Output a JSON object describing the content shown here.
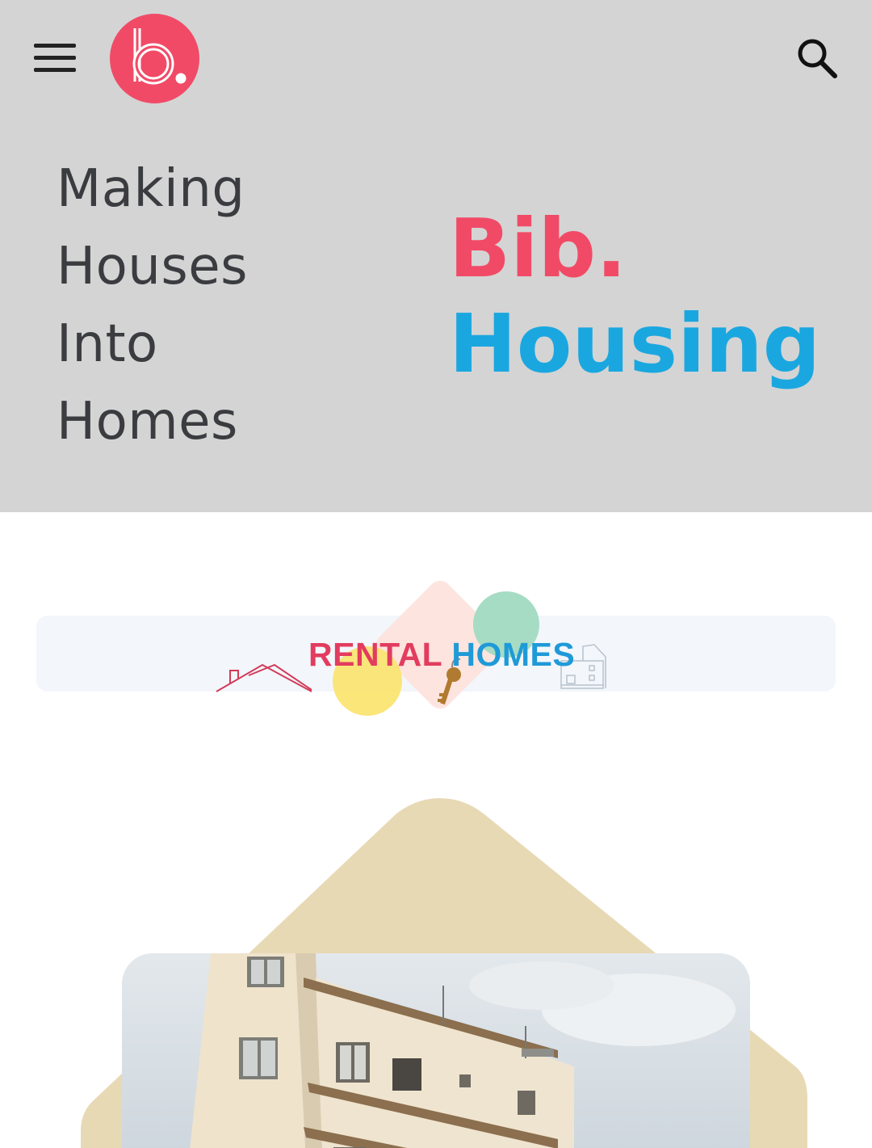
{
  "header": {
    "menu_icon": "hamburger-menu-icon",
    "logo_letter": "b.",
    "search_icon": "search-icon"
  },
  "hero": {
    "tagline": [
      "Making",
      "Houses",
      "Into",
      "Homes"
    ],
    "brand_line1": "Bib.",
    "brand_line2": "Housing"
  },
  "banner": {
    "title_part1": "RENTAL",
    "title_part2": "HOMES"
  },
  "colors": {
    "brand_pink": "#f14a67",
    "brand_blue": "#1aa7e0",
    "hero_bg": "#d4d4d4",
    "house_shape": "#e8d9b5"
  }
}
